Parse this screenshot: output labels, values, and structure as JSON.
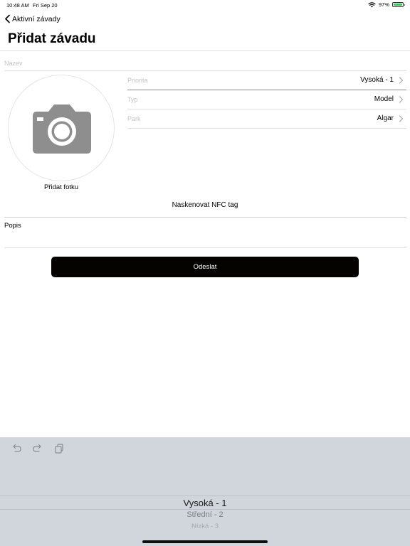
{
  "status_bar": {
    "time": "10:48 AM",
    "date": "Fri Sep 20",
    "battery": "97%",
    "battery_level": 0.97
  },
  "nav": {
    "back_label": "Aktivní závady",
    "title": "Přidat závadu"
  },
  "form": {
    "name_placeholder": "Název",
    "photo_label": "Přidat fotku",
    "fields": [
      {
        "label": "Priorita",
        "value": "Vysoká - 1"
      },
      {
        "label": "Typ",
        "value": "Model"
      },
      {
        "label": "Park",
        "value": "Algar"
      }
    ],
    "nfc_label": "Naskenovat NFC tag",
    "description_label": "Popis",
    "submit_label": "Odeslat"
  },
  "picker": {
    "options": [
      "Vysoká - 1",
      "Střední - 2",
      "Nízká - 3"
    ],
    "selected_index": 0
  },
  "colors": {
    "submit_bg": "#050300",
    "keyboard_bg": "#d1d5dc",
    "battery": "#34c759"
  },
  "icons": {
    "back": "chevron-left-icon",
    "photo": "camera-icon",
    "row": "chevron-right-icon",
    "undo": "undo-icon",
    "redo": "redo-icon",
    "paste": "paste-icon"
  }
}
